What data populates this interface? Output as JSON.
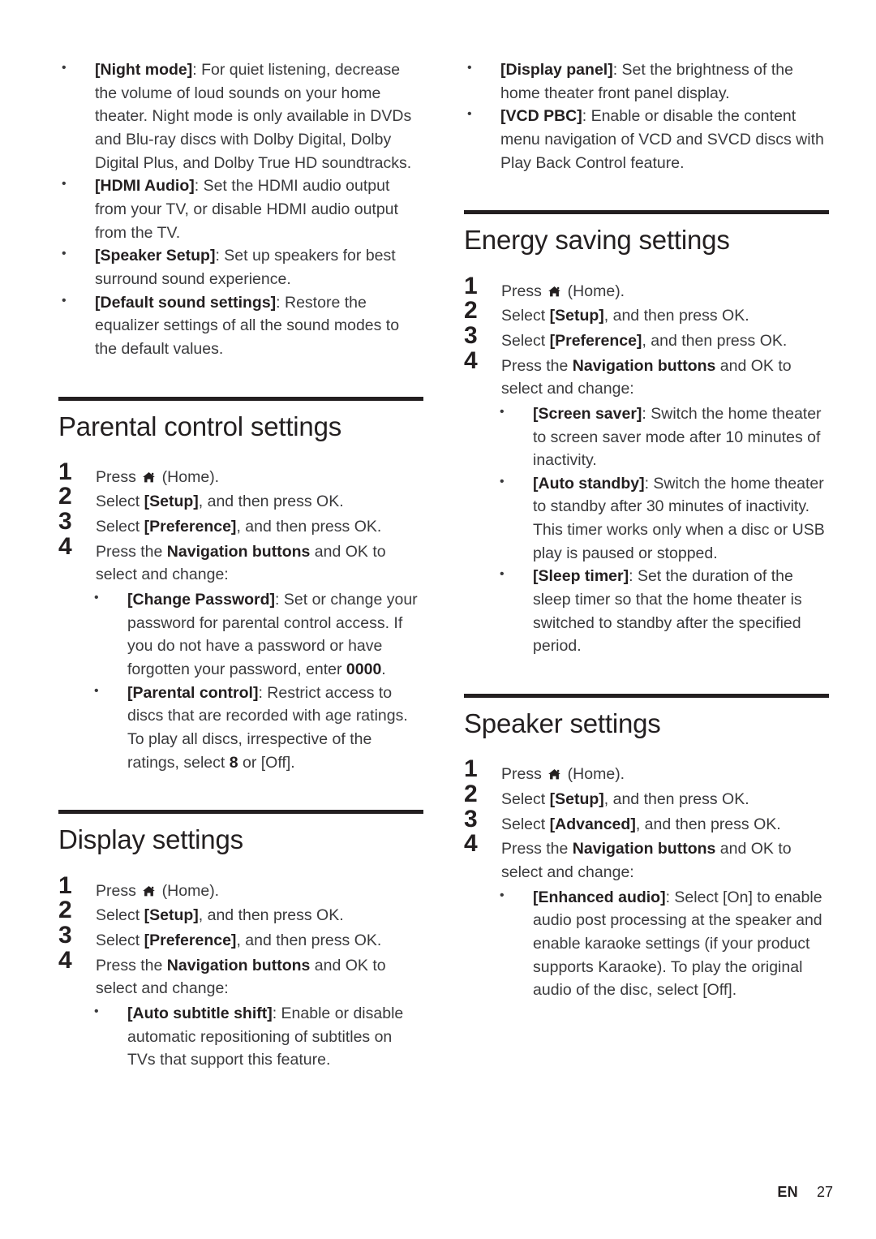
{
  "page": {
    "footer": {
      "language": "EN",
      "number": "27"
    },
    "home_icon_name": "home-icon"
  },
  "left_column": {
    "continued_bullets": [
      {
        "term": "[Night mode]",
        "text": ": For quiet listening, decrease the volume of loud sounds on your home theater. Night mode is only available in DVDs and Blu-ray discs with Dolby Digital, Dolby Digital Plus, and Dolby True HD soundtracks."
      },
      {
        "term": "[HDMI Audio]",
        "text": ": Set the HDMI audio output from your TV, or disable HDMI audio output from the TV."
      },
      {
        "term": "[Speaker Setup]",
        "text": ": Set up speakers for best surround sound experience."
      },
      {
        "term": "[Default sound settings]",
        "text": ": Restore the equalizer settings of all the sound modes to the default values."
      }
    ],
    "sections": [
      {
        "heading": "Parental control settings",
        "steps": [
          {
            "num": "1",
            "pre": "Press ",
            "icon": "home-icon",
            "post": " (Home)."
          },
          {
            "num": "2",
            "pre": "Select ",
            "bold": "[Setup]",
            "post": ", and then press OK."
          },
          {
            "num": "3",
            "pre": "Select ",
            "bold": "[Preference]",
            "post": ", and then press OK."
          },
          {
            "num": "4",
            "pre": "Press the ",
            "bold": "Navigation buttons",
            "post": " and OK to select and change:"
          }
        ],
        "bullets": [
          {
            "term": "[Change Password]",
            "text": ": Set or change your password for parental control access. If you do not have a password or have forgotten your password, enter ",
            "bold_tail": "0000",
            "tail": "."
          },
          {
            "term": "[Parental control]",
            "text": ": Restrict access to discs that are recorded with age ratings. To play all discs, irrespective of the ratings, select ",
            "bold_tail": "8",
            "tail": " or [Off]."
          }
        ]
      },
      {
        "heading": "Display settings",
        "steps": [
          {
            "num": "1",
            "pre": "Press ",
            "icon": "home-icon",
            "post": " (Home)."
          },
          {
            "num": "2",
            "pre": "Select ",
            "bold": "[Setup]",
            "post": ", and then press OK."
          },
          {
            "num": "3",
            "pre": "Select ",
            "bold": "[Preference]",
            "post": ", and then press OK."
          },
          {
            "num": "4",
            "pre": "Press the ",
            "bold": "Navigation buttons",
            "post": " and OK to select and change:"
          }
        ],
        "bullets": [
          {
            "term": "[Auto subtitle shift]",
            "text": ": Enable or disable automatic repositioning of subtitles on TVs that support this feature."
          }
        ]
      }
    ]
  },
  "right_column": {
    "continued_bullets": [
      {
        "term": "[Display panel]",
        "text": ": Set the brightness of the home theater front panel display."
      },
      {
        "term": "[VCD PBC]",
        "text": ": Enable or disable the content menu navigation of VCD and SVCD discs with Play Back Control feature."
      }
    ],
    "sections": [
      {
        "heading": "Energy saving settings",
        "steps": [
          {
            "num": "1",
            "pre": "Press ",
            "icon": "home-icon",
            "post": " (Home)."
          },
          {
            "num": "2",
            "pre": "Select ",
            "bold": "[Setup]",
            "post": ", and then press OK."
          },
          {
            "num": "3",
            "pre": "Select ",
            "bold": "[Preference]",
            "post": ", and then press OK."
          },
          {
            "num": "4",
            "pre": "Press the ",
            "bold": "Navigation buttons",
            "post": " and OK to select and change:"
          }
        ],
        "bullets": [
          {
            "term": "[Screen saver]",
            "text": ": Switch the home theater to screen saver mode after 10 minutes of inactivity."
          },
          {
            "term": "[Auto standby]",
            "text": ": Switch the home theater to standby after 30 minutes of inactivity. This timer works only when a disc or USB play is paused or stopped."
          },
          {
            "term": "[Sleep timer]",
            "text": ": Set the duration of the sleep timer so that the home theater is switched to standby after the specified period."
          }
        ]
      },
      {
        "heading": "Speaker settings",
        "steps": [
          {
            "num": "1",
            "pre": "Press ",
            "icon": "home-icon",
            "post": " (Home)."
          },
          {
            "num": "2",
            "pre": "Select ",
            "bold": "[Setup]",
            "post": ", and then press OK."
          },
          {
            "num": "3",
            "pre": "Select ",
            "bold": "[Advanced]",
            "post": ", and then press OK."
          },
          {
            "num": "4",
            "pre": "Press the ",
            "bold": "Navigation buttons",
            "post": " and OK to select and change:"
          }
        ],
        "bullets": [
          {
            "term": "[Enhanced audio]",
            "text": ": Select [On] to enable audio post processing at the speaker and enable karaoke settings (if your product supports Karaoke). To play the original audio of the disc, select [Off]."
          }
        ]
      }
    ]
  }
}
